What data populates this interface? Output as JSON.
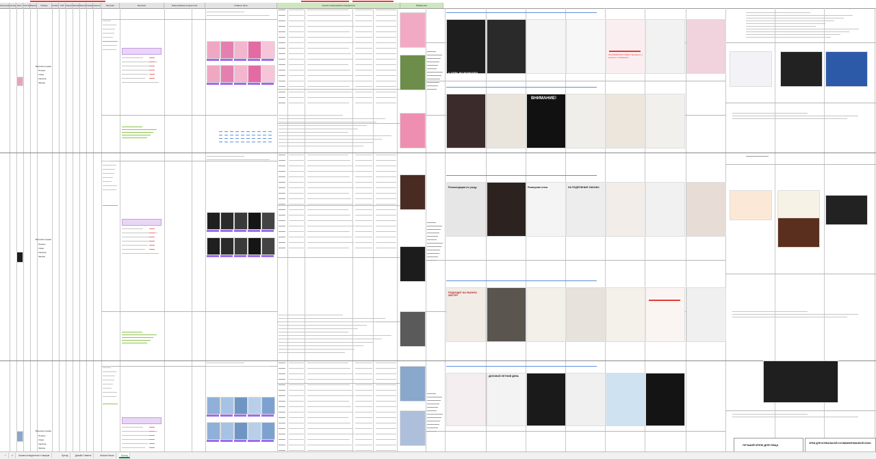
{
  "header": {
    "columns": [
      {
        "label": "Категория"
      },
      {
        "label": "Артикул"
      },
      {
        "label": "Фото"
      },
      {
        "label": "Ссылка"
      },
      {
        "label": "Воронка продаж"
      },
      {
        "label": "Показы"
      },
      {
        "label": "Клики"
      },
      {
        "label": "CTR"
      },
      {
        "label": "Корзина"
      },
      {
        "label": "Заказы"
      },
      {
        "label": "Выкупы"
      },
      {
        "label": "Конверсия"
      },
      {
        "label": "Анализ карточки"
      },
      {
        "label": "Метрики"
      },
      {
        "label": "Воронка"
      },
      {
        "label": "Инфографика конкурентов"
      },
      {
        "label": "Главные фото"
      },
      {
        "label": "Анализ инфографики конкурентов"
      },
      {
        "label": "Референсы"
      }
    ]
  },
  "rows": [
    {
      "section_label": "Воронка продаж",
      "funnel_items": [
        "Показы",
        "Клики",
        "Корзина",
        "Заказы"
      ],
      "cards": [
        {
          "title": "ВНИМАНИЕ!",
          "kind": "dark"
        },
        {
          "title": "С УТРА ДО НОЧИ БЕЗ ОГРАНИЧЕНИЙ",
          "kind": "pink"
        },
        {
          "title": "ПОНРАВИЛСЯ ТОВАР? Добавьте в корзину и избранное!",
          "kind": "promo"
        }
      ]
    },
    {
      "section_label": "Воронка продаж",
      "funnel_items": [
        "Показы",
        "Клики",
        "Корзина",
        "Заказы"
      ],
      "cards": [
        {
          "title": "Рекомендации по уходу",
          "kind": "dark"
        },
        {
          "title": "Размерная сетка",
          "kind": "light"
        },
        {
          "title": "НА ПОДРОБНЫЕ ЗАКАЗЫ",
          "kind": "light"
        },
        {
          "title": "ПОДХОДИТ НА РАЗНУЮ ФИГУРУ",
          "kind": "light"
        }
      ]
    },
    {
      "section_label": "Воронка продаж",
      "funnel_items": [
        "Показы",
        "Клики",
        "Корзина",
        "Заказы"
      ],
      "cards": [
        {
          "title": "ДЕЛОВОЙ ЛЕТНИЙ ДЕНЬ",
          "kind": "light"
        },
        {
          "title": "ЛУЧШИЙ КРЕМ ДЛЯ ЛИЦА",
          "kind": "light"
        },
        {
          "title": "КРЕМ ДЛЯ НОРМАЛЬНОЙ И КОМБИНИРОВАННОЙ КОЖИ",
          "kind": "light"
        }
      ]
    }
  ],
  "tabs": [
    {
      "label": "+"
    },
    {
      "label": "≡"
    },
    {
      "label": "Анализ конкурентов и товаров"
    },
    {
      "label": "Бренд"
    },
    {
      "label": "Дизайн Главное"
    },
    {
      "label": "Анализ Ниши"
    },
    {
      "label": "Бренд"
    }
  ],
  "active_tab_index": 6,
  "colors": {
    "accent_green": "#188038",
    "header_green": "#cfe6bf",
    "marker_red": "#e53935",
    "swatch_purple": "#9b6cf0"
  }
}
